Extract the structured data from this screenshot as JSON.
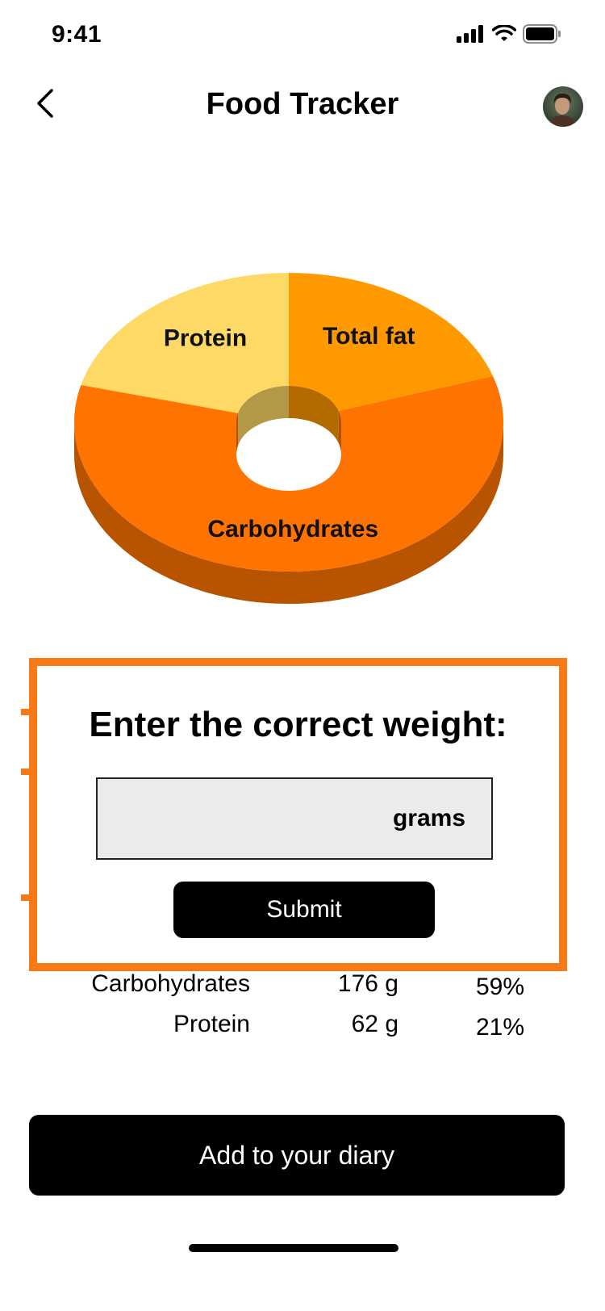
{
  "status_bar": {
    "time": "9:41"
  },
  "header": {
    "title": "Food Tracker"
  },
  "chart_data": {
    "type": "pie",
    "style": "3d-donut",
    "categories": [
      "Total fat",
      "Carbohydrates",
      "Protein"
    ],
    "values": [
      20,
      59,
      21
    ],
    "colors": [
      "#ff9900",
      "#ff7300",
      "#ffd966"
    ]
  },
  "nutrients": [
    {
      "name": "Carbohydrates",
      "amount": "176 g",
      "percent": "59%"
    },
    {
      "name": "Protein",
      "amount": "62 g",
      "percent": "21%"
    }
  ],
  "dialog": {
    "title": "Enter the correct weight:",
    "input_value": "",
    "unit": "grams",
    "submit_label": "Submit",
    "accent": "#f87a17"
  },
  "bottom": {
    "cta_label": "Add to your diary"
  }
}
